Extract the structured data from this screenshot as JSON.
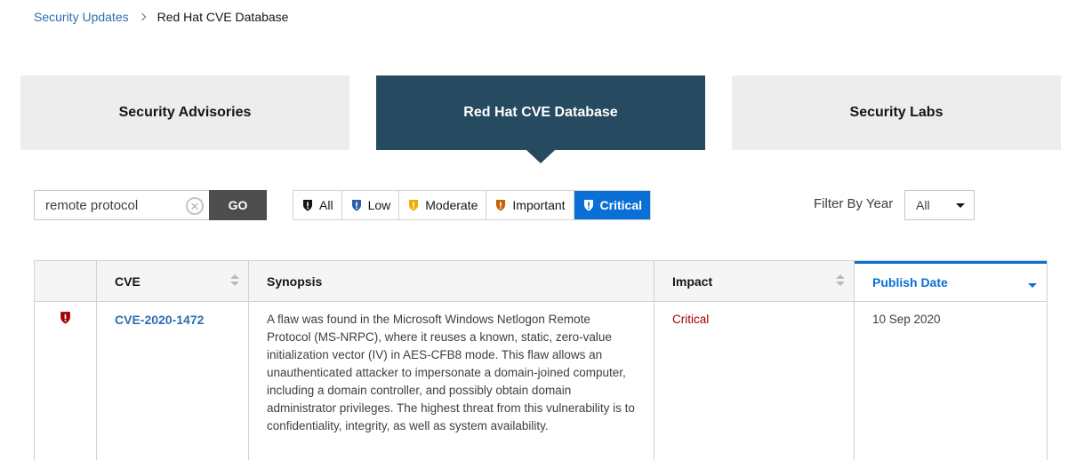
{
  "breadcrumb": {
    "parent": "Security Updates",
    "current": "Red Hat CVE Database"
  },
  "tabs": [
    {
      "label": "Security Advisories",
      "active": false
    },
    {
      "label": "Red Hat CVE Database",
      "active": true
    },
    {
      "label": "Security Labs",
      "active": false
    }
  ],
  "search": {
    "value": "remote protocol",
    "go_label": "GO"
  },
  "filters": [
    {
      "label": "All",
      "icon": "shield-icon",
      "color": "#151515",
      "active": false
    },
    {
      "label": "Low",
      "icon": "shield-icon",
      "color": "#2b5ea7",
      "active": false
    },
    {
      "label": "Moderate",
      "icon": "shield-icon",
      "color": "#f0ab00",
      "active": false
    },
    {
      "label": "Important",
      "icon": "shield-icon",
      "color": "#c46100",
      "active": false
    },
    {
      "label": "Critical",
      "icon": "shield-icon",
      "color": "#ffffff",
      "active": true
    }
  ],
  "year_filter": {
    "label": "Filter By Year",
    "selected": "All"
  },
  "table": {
    "headers": {
      "cve": "CVE",
      "synopsis": "Synopsis",
      "impact": "Impact",
      "publish_date": "Publish Date"
    },
    "rows": [
      {
        "severity_icon": "shield-icon",
        "severity_color": "#a30000",
        "cve": "CVE-2020-1472",
        "synopsis": "A flaw was found in the Microsoft Windows Netlogon Remote Protocol (MS-NRPC), where it reuses a known, static, zero-value initialization vector (IV) in AES-CFB8 mode. This flaw allows an unauthenticated attacker to impersonate a domain-joined computer, including a domain controller, and possibly obtain domain administrator privileges. The highest threat from this vulnerability is to confidentiality, integrity, as well as system availability.",
        "impact": "Critical",
        "publish_date": "10 Sep 2020"
      }
    ]
  },
  "colors": {
    "accent": "#0a6fd6",
    "active_tab": "#264a60",
    "critical": "#a30000",
    "link": "#2f6db3"
  }
}
